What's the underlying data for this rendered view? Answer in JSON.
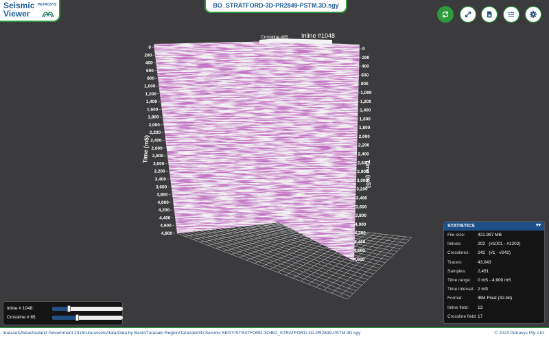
{
  "app": {
    "title_line1": "Seismic",
    "title_line2": "Viewer",
    "brand": "PETROSYS"
  },
  "file_title": "BO_STRATFORD-3D-PR2849-PSTM.3D.sgy",
  "toolbar": {
    "buttons": [
      {
        "name": "reset-view-button",
        "icon": "rotate-view-icon",
        "active": true
      },
      {
        "name": "fullscreen-button",
        "icon": "expand-icon"
      },
      {
        "name": "file-info-button",
        "icon": "document-icon"
      },
      {
        "name": "list-button",
        "icon": "list-icon"
      },
      {
        "name": "settings-button",
        "icon": "gear-icon"
      }
    ]
  },
  "scene": {
    "crossline_label": "Crossline #85",
    "inline_label": "Inline #1048",
    "axis_title": "Time (mS)",
    "left_ticks": [
      "0",
      "200",
      "400",
      "600",
      "800",
      "1,000",
      "1,200",
      "1,400",
      "1,600",
      "1,800",
      "2,000",
      "2,200",
      "2,400",
      "2,600",
      "2,800",
      "3,000",
      "3,200",
      "3,400",
      "3,600",
      "3,800",
      "4,000",
      "4,200",
      "4,400",
      "4,600",
      "4,800"
    ],
    "right_ticks": [
      "0",
      "200",
      "400",
      "600",
      "800",
      "1,000",
      "1,200",
      "1,400",
      "1,600",
      "1,800",
      "2,000",
      "2,200",
      "2,400",
      "2,600",
      "2,800",
      "3,000",
      "3,200",
      "3,400",
      "3,600",
      "3,800",
      "4,000",
      "4,200",
      "4,400",
      "4,600",
      "4,800"
    ]
  },
  "stats": {
    "title": "STATISTICS",
    "rows": [
      {
        "label": "File size:",
        "value": "421.997 MB"
      },
      {
        "label": "Inlines:",
        "value": "202   (#1001 - #1202)"
      },
      {
        "label": "Crosslines:",
        "value": "242   (#1 - #242)"
      },
      {
        "label": "Traces:",
        "value": "43,043"
      },
      {
        "label": "Samples:",
        "value": "2,451"
      },
      {
        "label": "Time range:",
        "value": "0 mS - 4,900 mS"
      },
      {
        "label": "Time interval:",
        "value": "2 mS"
      },
      {
        "label": "Format:",
        "value": "IBM Float (32-bit)"
      },
      {
        "label": "Inline field:",
        "value": "13"
      },
      {
        "label": "Crossline field:",
        "value": "17"
      }
    ]
  },
  "sliders": {
    "inline": {
      "label": "Inline # 1048:",
      "fraction": 0.23
    },
    "crossline": {
      "label": "Crossline # 85:",
      "fraction": 0.35
    }
  },
  "footer": {
    "path": "/datasets/NewZealand Government 2015/site/assets/data/Data by Basin/Taranaki Region/Taranaki/3D Seismic SEGY/STRATFORD-3D/BO_STRATFORD-3D-PR2849-PSTM.3D.sgy",
    "copyright": "© 2023 Petrosys Pty. Ltd."
  },
  "colors": {
    "accent": "#2e9a3e",
    "brand_blue": "#1f5c99",
    "seismic": "#8a2c8a"
  }
}
